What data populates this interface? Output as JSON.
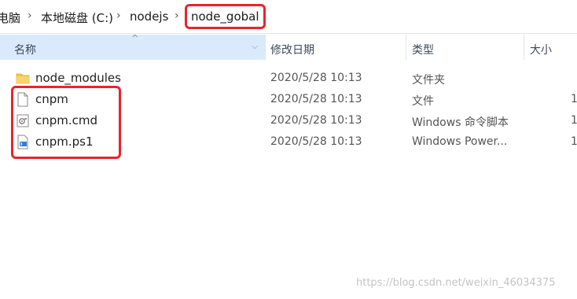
{
  "breadcrumb": {
    "items": [
      "电脑",
      "本地磁盘 (C:)",
      "nodejs",
      "node_gobal"
    ],
    "separator": "›"
  },
  "columns": {
    "name": "名称",
    "date": "修改日期",
    "type": "类型",
    "size": "大小"
  },
  "files": [
    {
      "name": "node_modules",
      "date": "2020/5/28 10:13",
      "type": "文件夹",
      "size": "",
      "icon": "folder-icon"
    },
    {
      "name": "cnpm",
      "date": "2020/5/28 10:13",
      "type": "文件",
      "size": "1",
      "icon": "file-icon"
    },
    {
      "name": "cnpm.cmd",
      "date": "2020/5/28 10:13",
      "type": "Windows 命令脚本",
      "size": "1",
      "icon": "cmd-script-icon"
    },
    {
      "name": "cnpm.ps1",
      "date": "2020/5/28 10:13",
      "type": "Windows Power...",
      "size": "1",
      "icon": "powershell-script-icon"
    }
  ],
  "watermark": "https://blog.csdn.net/weixin_46034375",
  "colors": {
    "highlight": "#e8242b",
    "header_selected": "#d9ebfb",
    "folder": "#f4c542"
  }
}
